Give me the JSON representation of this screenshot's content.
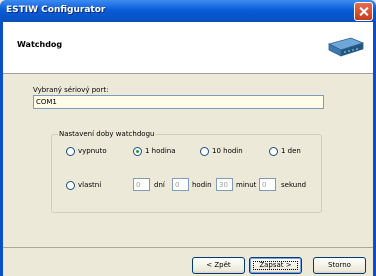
{
  "window": {
    "title": "ESTIW Configurator"
  },
  "header": {
    "title": "Watchdog",
    "image": "modem-icon"
  },
  "port": {
    "label": "Vybraný sériový port:",
    "value": "COM1"
  },
  "watchdog": {
    "group_label": "Nastavení doby watchdogu",
    "options": [
      {
        "label": "vypnuto",
        "checked": false
      },
      {
        "label": "1 hodina",
        "checked": true
      },
      {
        "label": "10 hodin",
        "checked": false
      },
      {
        "label": "1 den",
        "checked": false
      }
    ],
    "custom": {
      "label": "vlastní",
      "days_value": "0",
      "days_label": "dní",
      "hours_value": "0",
      "hours_label": "hodin",
      "minutes_value": "30",
      "minutes_label": "minut",
      "seconds_value": "0",
      "seconds_label": "sekund"
    }
  },
  "buttons": {
    "back": "< Zpět",
    "next": "Zapsat >",
    "cancel": "Storno"
  }
}
